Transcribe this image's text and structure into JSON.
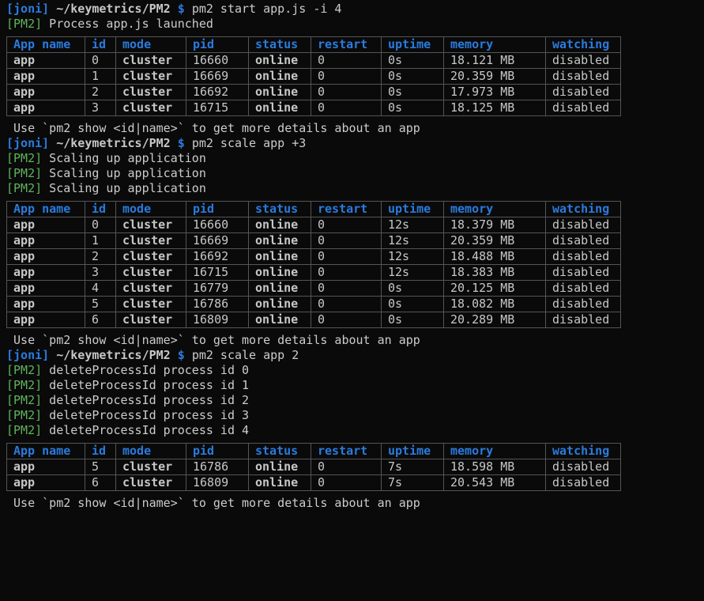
{
  "prompt_user_open": "[joni]",
  "prompt_path": " ~/keymetrics/PM2 ",
  "prompt_dollar": "$ ",
  "hint": " Use `pm2 show <id|name>` to get more details about an app",
  "pm2_tag": "[PM2]",
  "headers": {
    "app": "App name",
    "id": "id",
    "mode": "mode",
    "pid": "pid",
    "status": "status",
    "restart": "restart",
    "uptime": "uptime",
    "memory": "memory",
    "watching": "watching"
  },
  "blocks": [
    {
      "cmd": "pm2 start app.js -i 4",
      "msgs": [
        " Process app.js launched"
      ],
      "rows": [
        {
          "app": "app",
          "id": "0",
          "mode": "cluster",
          "pid": "16660",
          "status": "online",
          "restart": "0",
          "uptime": "0s",
          "memory": "18.121 MB",
          "watching": "disabled"
        },
        {
          "app": "app",
          "id": "1",
          "mode": "cluster",
          "pid": "16669",
          "status": "online",
          "restart": "0",
          "uptime": "0s",
          "memory": "20.359 MB",
          "watching": "disabled"
        },
        {
          "app": "app",
          "id": "2",
          "mode": "cluster",
          "pid": "16692",
          "status": "online",
          "restart": "0",
          "uptime": "0s",
          "memory": "17.973 MB",
          "watching": "disabled"
        },
        {
          "app": "app",
          "id": "3",
          "mode": "cluster",
          "pid": "16715",
          "status": "online",
          "restart": "0",
          "uptime": "0s",
          "memory": "18.125 MB",
          "watching": "disabled"
        }
      ]
    },
    {
      "cmd": "pm2 scale app +3",
      "msgs": [
        " Scaling up application",
        " Scaling up application",
        " Scaling up application"
      ],
      "rows": [
        {
          "app": "app",
          "id": "0",
          "mode": "cluster",
          "pid": "16660",
          "status": "online",
          "restart": "0",
          "uptime": "12s",
          "memory": "18.379 MB",
          "watching": "disabled"
        },
        {
          "app": "app",
          "id": "1",
          "mode": "cluster",
          "pid": "16669",
          "status": "online",
          "restart": "0",
          "uptime": "12s",
          "memory": "20.359 MB",
          "watching": "disabled"
        },
        {
          "app": "app",
          "id": "2",
          "mode": "cluster",
          "pid": "16692",
          "status": "online",
          "restart": "0",
          "uptime": "12s",
          "memory": "18.488 MB",
          "watching": "disabled"
        },
        {
          "app": "app",
          "id": "3",
          "mode": "cluster",
          "pid": "16715",
          "status": "online",
          "restart": "0",
          "uptime": "12s",
          "memory": "18.383 MB",
          "watching": "disabled"
        },
        {
          "app": "app",
          "id": "4",
          "mode": "cluster",
          "pid": "16779",
          "status": "online",
          "restart": "0",
          "uptime": "0s",
          "memory": "20.125 MB",
          "watching": "disabled"
        },
        {
          "app": "app",
          "id": "5",
          "mode": "cluster",
          "pid": "16786",
          "status": "online",
          "restart": "0",
          "uptime": "0s",
          "memory": "18.082 MB",
          "watching": "disabled"
        },
        {
          "app": "app",
          "id": "6",
          "mode": "cluster",
          "pid": "16809",
          "status": "online",
          "restart": "0",
          "uptime": "0s",
          "memory": "20.289 MB",
          "watching": "disabled"
        }
      ]
    },
    {
      "cmd": "pm2 scale app 2",
      "msgs": [
        " deleteProcessId process id 0",
        " deleteProcessId process id 1",
        " deleteProcessId process id 2",
        " deleteProcessId process id 3",
        " deleteProcessId process id 4"
      ],
      "rows": [
        {
          "app": "app",
          "id": "5",
          "mode": "cluster",
          "pid": "16786",
          "status": "online",
          "restart": "0",
          "uptime": "7s",
          "memory": "18.598 MB",
          "watching": "disabled"
        },
        {
          "app": "app",
          "id": "6",
          "mode": "cluster",
          "pid": "16809",
          "status": "online",
          "restart": "0",
          "uptime": "7s",
          "memory": "20.543 MB",
          "watching": "disabled"
        }
      ]
    }
  ]
}
